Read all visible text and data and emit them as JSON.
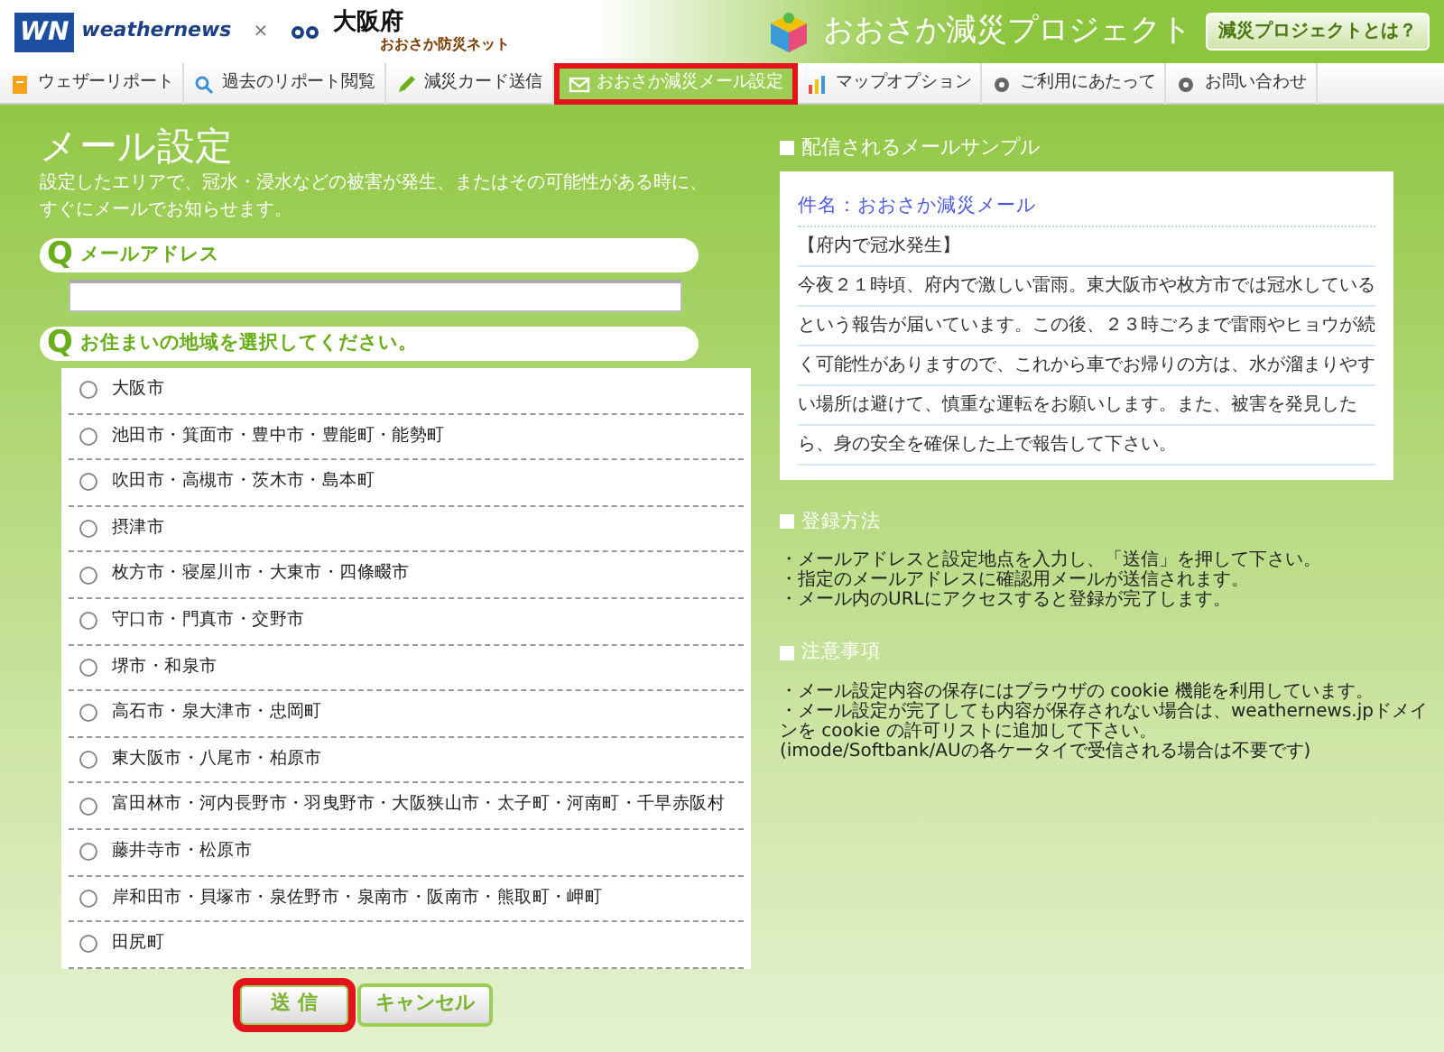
{
  "header": {
    "logo_mark": "WN",
    "logo_text": "weathernews",
    "separator": "×",
    "partner": "大阪府",
    "partner_sub": "おおさか防災ネット",
    "project_title": "おおさか減災プロジェクト",
    "about_button": "減災プロジェクトとは？"
  },
  "nav": [
    {
      "label": "ウェザーリポート",
      "kind": "document",
      "selected": false,
      "highlighted": false
    },
    {
      "label": "過去のリポート閲覧",
      "kind": "search",
      "selected": false,
      "highlighted": false
    },
    {
      "label": "減災カード送信",
      "kind": "pencil",
      "selected": false,
      "highlighted": false
    },
    {
      "label": "おおさか減災メール設定",
      "kind": "mail",
      "selected": true,
      "highlighted": true
    },
    {
      "label": "マップオプション",
      "kind": "chart",
      "selected": false,
      "highlighted": false
    },
    {
      "label": "ご利用にあたって",
      "kind": "info",
      "selected": false,
      "highlighted": false
    },
    {
      "label": "お問い合わせ",
      "kind": "info",
      "selected": false,
      "highlighted": false
    }
  ],
  "form": {
    "title": "メール設定",
    "description": "設定したエリアで、冠水・浸水などの被害が発生、またはその可能性がある時に、すぐにメールでお知らせます。",
    "questions": [
      {
        "marker": "Q",
        "label": "メールアドレス",
        "kind": "text"
      },
      {
        "marker": "Q",
        "label": "お住まいの地域を選択してください。",
        "kind": "choices"
      }
    ],
    "areas": [
      {
        "label": "大阪市",
        "selected": false
      },
      {
        "label": "池田市・箕面市・豊中市・豊能町・能勢町",
        "selected": false
      },
      {
        "label": "吹田市・高槻市・茨木市・島本町",
        "selected": false
      },
      {
        "label": "摂津市",
        "selected": false
      },
      {
        "label": "枚方市・寝屋川市・大東市・四條畷市",
        "selected": false
      },
      {
        "label": "守口市・門真市・交野市",
        "selected": false
      },
      {
        "label": "堺市・和泉市",
        "selected": false
      },
      {
        "label": "高石市・泉大津市・忠岡町",
        "selected": false
      },
      {
        "label": "東大阪市・八尾市・柏原市",
        "selected": false
      },
      {
        "label": "富田林市・河内長野市・羽曳野市・大阪狭山市・太子町・河南町・千早赤阪村",
        "selected": false
      },
      {
        "label": "藤井寺市・松原市",
        "selected": false
      },
      {
        "label": "岸和田市・貝塚市・泉佐野市・泉南市・阪南市・熊取町・岬町",
        "selected": false
      },
      {
        "label": "田尻町",
        "selected": false
      }
    ],
    "buttons": [
      {
        "label": "送 信",
        "kind": "submit",
        "highlighted": true
      },
      {
        "label": "キャンセル",
        "kind": "cancel",
        "highlighted": false
      }
    ]
  },
  "sample": {
    "heading": "配信されるメールサンプル",
    "subject": "件名：おおさか減災メール",
    "headline": "【府内で冠水発生】",
    "body": "今夜２１時頃、府内で激しい雷雨。東大阪市や枚方市では冠水しているという報告が届いています。この後、２３時ごろまで雷雨やヒョウが続く可能性がありますので、これから車でお帰りの方は、水が溜まりやすい場所は避けて、慎重な運転をお願いします。また、被害を発見したら、身の安全を確保した上で報告して下さい。"
  },
  "info": [
    {
      "heading": "登録方法",
      "notes": [
        "・メールアドレスと設定地点を入力し、「送信」を押して下さい。",
        "・指定のメールアドレスに確認用メールが送信されます。",
        "・メール内のURLにアクセスすると登録が完了します。"
      ]
    },
    {
      "heading": "注意事項",
      "notes": [
        "・メール設定内容の保存にはブラウザの cookie 機能を利用しています。",
        "・メール設定が完了しても内容が保存されない場合は、weathernews.jpドメインを cookie の許可リストに追加して下さい。",
        "(imode/Softbank/AUの各ケータイで受信される場合は不要です)"
      ]
    }
  ]
}
